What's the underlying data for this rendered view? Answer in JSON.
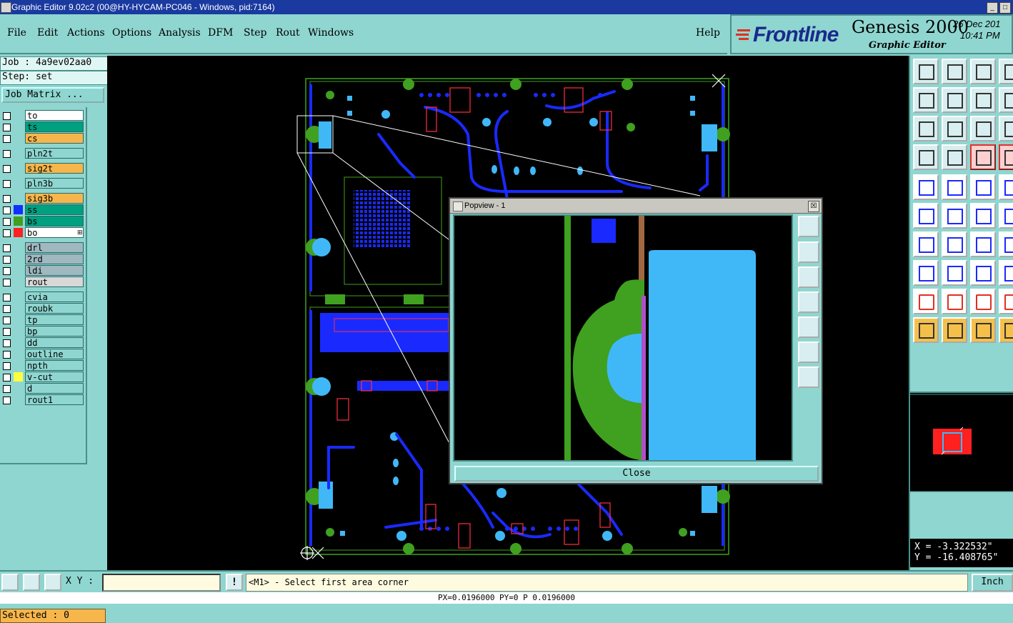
{
  "window": {
    "title": "Graphic Editor 9.02c2 (00@HY-HYCAM-PC046 - Windows, pid:7164)",
    "min_glyph": "_",
    "max_glyph": "□"
  },
  "menu": {
    "items": [
      "File",
      "Edit",
      "Actions",
      "Options",
      "Analysis",
      "DFM",
      "Step",
      "Rout",
      "Windows"
    ],
    "help": "Help"
  },
  "brand": {
    "logo": "Frontline",
    "product": "Genesis 2000",
    "subtitle": "Graphic Editor",
    "date": "26 Dec 201",
    "time": "10:41 PM"
  },
  "left": {
    "job": "Job : 4a9ev02aa0",
    "step": "Step: set",
    "job_matrix": "Job Matrix ...",
    "selected": "Selected : 0",
    "layers": [
      {
        "name": "to",
        "bg": "#ffffff",
        "swatch": ""
      },
      {
        "name": "ts",
        "bg": "#00a080",
        "swatch": ""
      },
      {
        "name": "cs",
        "bg": "#f7b64b",
        "swatch": ""
      },
      {
        "name": "pln2t",
        "bg": "#8fd6d0",
        "swatch": "",
        "gap": true
      },
      {
        "name": "sig2t",
        "bg": "#f7b64b",
        "swatch": "",
        "gap": true
      },
      {
        "name": "pln3b",
        "bg": "#8fd6d0",
        "swatch": "",
        "gap": true
      },
      {
        "name": "sig3b",
        "bg": "#f7b64b",
        "swatch": "",
        "gap": true
      },
      {
        "name": "ss",
        "bg": "#00a080",
        "swatch": "#1030ff"
      },
      {
        "name": "bs",
        "bg": "#00a080",
        "swatch": "#40a020"
      },
      {
        "name": "bo",
        "bg": "#ffffff",
        "swatch": "#ff2020",
        "extra": "⊞"
      },
      {
        "name": "drl",
        "bg": "#a0b8c0",
        "swatch": "",
        "gap": true
      },
      {
        "name": "2rd",
        "bg": "#a0b8c0",
        "swatch": ""
      },
      {
        "name": "ldi",
        "bg": "#a0b8c0",
        "swatch": ""
      },
      {
        "name": "rout",
        "bg": "#d8d8d8",
        "swatch": ""
      },
      {
        "name": "cvia",
        "bg": "#8fd6d0",
        "swatch": "",
        "gap": true
      },
      {
        "name": "roubk",
        "bg": "#8fd6d0",
        "swatch": ""
      },
      {
        "name": "tp",
        "bg": "#8fd6d0",
        "swatch": ""
      },
      {
        "name": "bp",
        "bg": "#8fd6d0",
        "swatch": ""
      },
      {
        "name": "dd",
        "bg": "#8fd6d0",
        "swatch": ""
      },
      {
        "name": "outline",
        "bg": "#8fd6d0",
        "swatch": ""
      },
      {
        "name": "npth",
        "bg": "#8fd6d0",
        "swatch": ""
      },
      {
        "name": "v-cut",
        "bg": "#8fd6d0",
        "swatch": "#ffff40"
      },
      {
        "name": "d",
        "bg": "#8fd6d0",
        "swatch": ""
      },
      {
        "name": "rout1",
        "bg": "#8fd6d0",
        "swatch": ""
      }
    ]
  },
  "popview": {
    "title": "Popview - 1",
    "close_glyph": "☒",
    "close_label": "Close"
  },
  "coords": {
    "x": "X = -3.322532\"",
    "y": "Y = -16.408765\""
  },
  "bottom": {
    "xy_label": "X Y :",
    "xy_value": "",
    "excl": "!",
    "message": "<M1> - Select first area corner",
    "unit": "Inch",
    "status": "PX=0.0196000 PY=0 P 0.0196000"
  },
  "colors": {
    "panel": "#8fd6d0",
    "titlebar": "#1a3aa0",
    "trace_blue": "#1a2aff",
    "pad_light": "#40b8f8",
    "pad_green": "#40a020"
  }
}
